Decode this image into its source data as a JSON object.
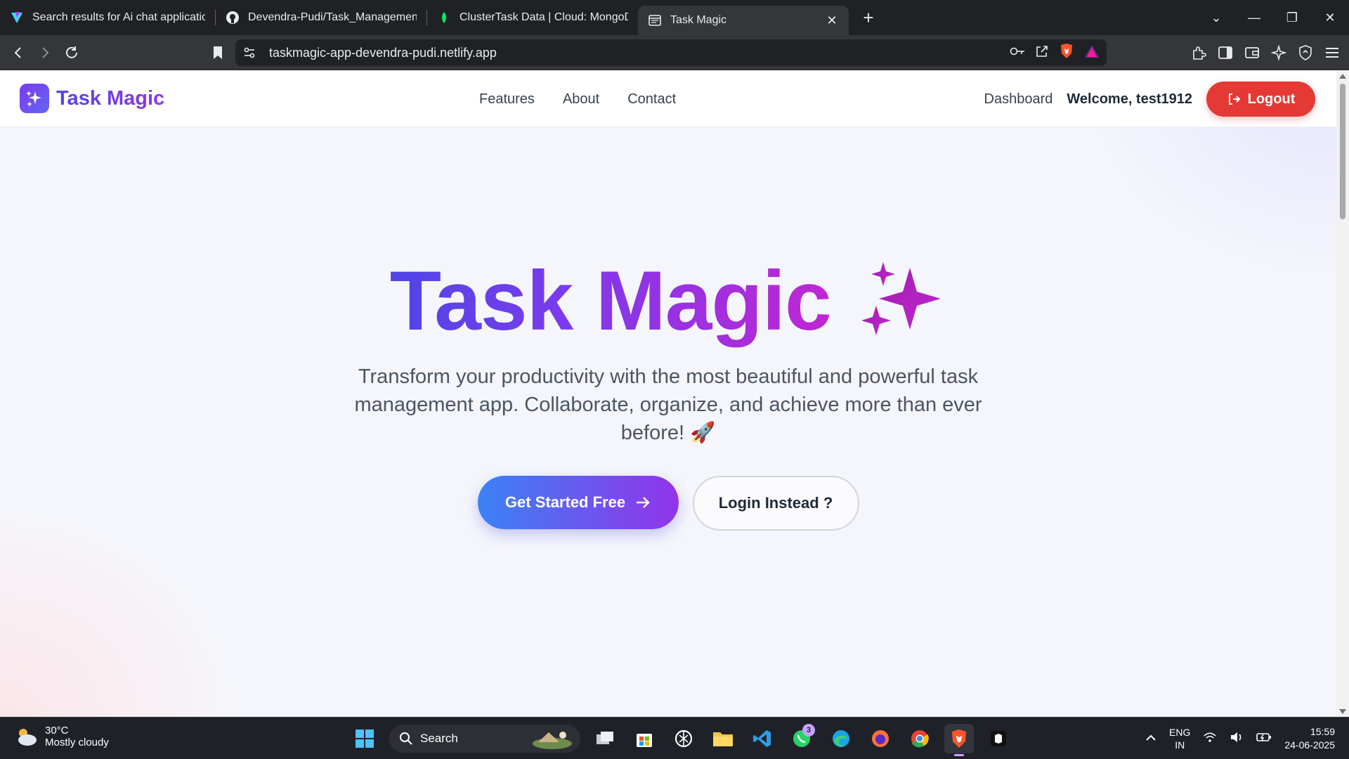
{
  "browser": {
    "tabs": [
      {
        "title": "Search results for Ai chat application",
        "icon": "vite-favicon",
        "active": false
      },
      {
        "title": "Devendra-Pudi/Task_Management_A",
        "icon": "github-icon",
        "active": false
      },
      {
        "title": "ClusterTask Data | Cloud: MongoDB C",
        "icon": "mongodb-leaf-icon",
        "active": false
      },
      {
        "title": "Task Magic",
        "icon": "page-icon",
        "active": true
      }
    ],
    "url": "taskmagic-app-devendra-pudi.netlify.app"
  },
  "header": {
    "brand": "Task Magic",
    "nav": [
      "Features",
      "About",
      "Contact"
    ],
    "dashboard": "Dashboard",
    "welcome": "Welcome, test1912",
    "logout": "Logout"
  },
  "hero": {
    "title": "Task Magic",
    "subtitle": "Transform your productivity with the most beautiful and powerful task management app. Collaborate, organize, and achieve more than ever before! 🚀",
    "primary_cta": "Get Started Free",
    "secondary_cta": "Login Instead ?"
  },
  "taskbar": {
    "temp": "30°C",
    "condition": "Mostly cloudy",
    "search_placeholder": "Search",
    "whatsapp_badge": "3",
    "lang_top": "ENG",
    "lang_bottom": "IN",
    "time": "15:59",
    "date": "24-06-2025"
  },
  "colors": {
    "accent_gradient_start": "#4f46e5",
    "accent_gradient_end": "#9333ea",
    "logout_red": "#e53935"
  }
}
